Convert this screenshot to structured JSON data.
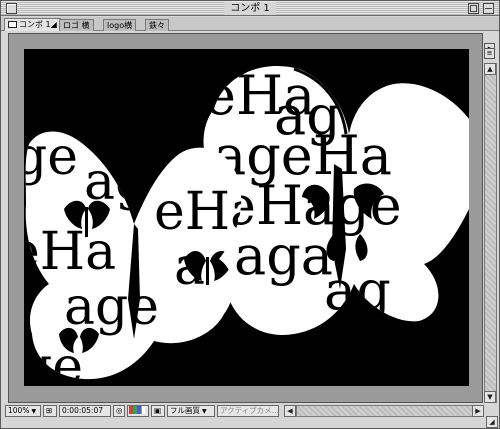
{
  "window": {
    "title": "コンポ 1"
  },
  "tabs": [
    {
      "label": "コンポ 1",
      "active": true
    },
    {
      "label": "ロゴ 横",
      "active": false
    },
    {
      "label": "logo横",
      "active": false
    },
    {
      "label": "鉄々",
      "active": false
    }
  ],
  "toolbar": {
    "zoom": "100%",
    "timecode": "0:00:05:07",
    "resolution": "フル画質",
    "camera": "アクティブカメ…"
  },
  "viewer": {
    "background": "#000000",
    "pasteboard": "#9a9a9a",
    "texture_text": [
      "eHa",
      "age",
      "ага",
      "еНа",
      "agen",
      "ena",
      "ena",
      "ageн",
      "ge",
      "еН"
    ]
  },
  "icons": {
    "close": "close-box",
    "zoom": "zoom-box",
    "collapse": "collapse-box",
    "tab_options": "triangle-right-icon",
    "comp_tab": "composition-icon"
  }
}
